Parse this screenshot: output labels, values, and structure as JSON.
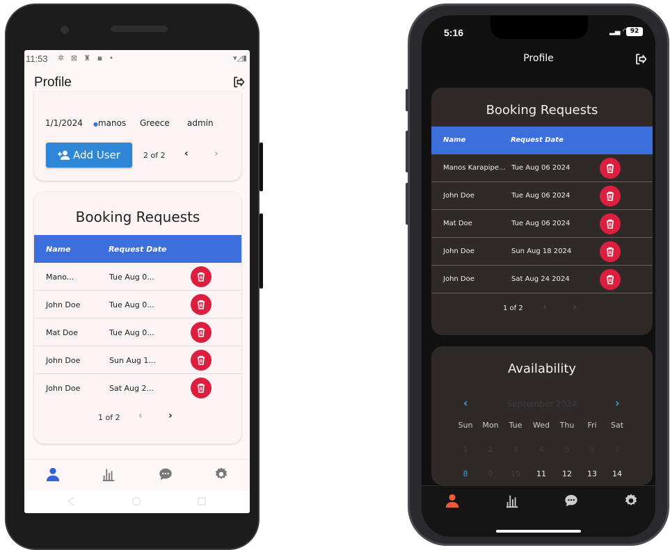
{
  "android": {
    "status": {
      "time": "11:53",
      "icons": "✲ ⊠ ♜ ▪ •",
      "right": "▾◿▮"
    },
    "title": "Profile",
    "users_row": {
      "date": "1/1/2024",
      "name": "manos",
      "country": "Greece",
      "role": "admin"
    },
    "add_user_label": "Add User",
    "users_pager": "2 of 2",
    "booking": {
      "title": "Booking Requests",
      "col_name": "Name",
      "col_date": "Request Date",
      "rows": [
        {
          "name": "Mano...",
          "date": "Tue Aug 0..."
        },
        {
          "name": "John Doe",
          "date": "Tue Aug 0..."
        },
        {
          "name": "Mat Doe",
          "date": "Tue Aug 0..."
        },
        {
          "name": "John Doe",
          "date": "Sun Aug 1..."
        },
        {
          "name": "John Doe",
          "date": "Sat Aug 2..."
        }
      ],
      "pager": "1 of 2"
    }
  },
  "iphone": {
    "status": {
      "time": "5:16",
      "battery": "92"
    },
    "title": "Profile",
    "booking": {
      "title": "Booking Requests",
      "col_name": "Name",
      "col_date": "Request Date",
      "rows": [
        {
          "name": "Manos Karapipe...",
          "date": "Tue Aug 06 2024"
        },
        {
          "name": "John Doe",
          "date": "Tue Aug 06 2024"
        },
        {
          "name": "Mat Doe",
          "date": "Tue Aug 06 2024"
        },
        {
          "name": "John Doe",
          "date": "Sun Aug 18 2024"
        },
        {
          "name": "John Doe",
          "date": "Sat Aug 24 2024"
        }
      ],
      "pager": "1 of 2"
    },
    "availability": {
      "title": "Availability",
      "month": "September 2024",
      "weekdays": [
        "Sun",
        "Mon",
        "Tue",
        "Wed",
        "Thu",
        "Fri",
        "Sat"
      ],
      "week1": [
        "1",
        "2",
        "3",
        "4",
        "5",
        "6",
        "7"
      ],
      "week2": [
        "8",
        "9",
        "10",
        "11",
        "12",
        "13",
        "14"
      ]
    }
  },
  "colors": {
    "accent_blue": "#3c6fdc",
    "button_blue": "#2e86d7",
    "delete_red": "#dc1f3f",
    "active_nav_android": "#2f63d6",
    "active_nav_ios": "#f05a3c"
  }
}
